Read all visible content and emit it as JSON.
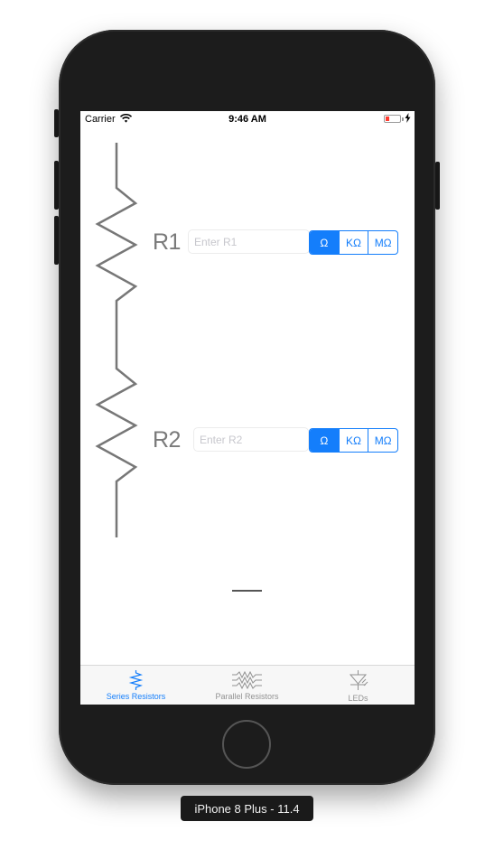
{
  "status_bar": {
    "carrier": "Carrier",
    "time": "9:46 AM",
    "wifi_icon": "wifi-icon",
    "battery_icon": "battery-low-icon",
    "charging_icon": "charging-bolt-icon",
    "battery_color": "#ff3b30"
  },
  "resistors": [
    {
      "label": "R1",
      "placeholder": "Enter R1",
      "value": "",
      "units": [
        "Ω",
        "KΩ",
        "MΩ"
      ],
      "selected_unit": "Ω"
    },
    {
      "label": "R2",
      "placeholder": "Enter R2",
      "value": "",
      "units": [
        "Ω",
        "KΩ",
        "MΩ"
      ],
      "selected_unit": "Ω"
    }
  ],
  "total": {
    "value": ""
  },
  "tab_bar": {
    "tabs": [
      {
        "label": "Series Resistors",
        "icon": "series-resistor-icon",
        "active": true
      },
      {
        "label": "Parallel Resistors",
        "icon": "parallel-resistor-icon",
        "active": false
      },
      {
        "label": "LEDs",
        "icon": "led-icon",
        "active": false
      }
    ]
  },
  "device": {
    "label": "iPhone 8 Plus - 11.4"
  },
  "colors": {
    "accent": "#147efb",
    "inactive": "#929292",
    "wire": "#777777"
  }
}
